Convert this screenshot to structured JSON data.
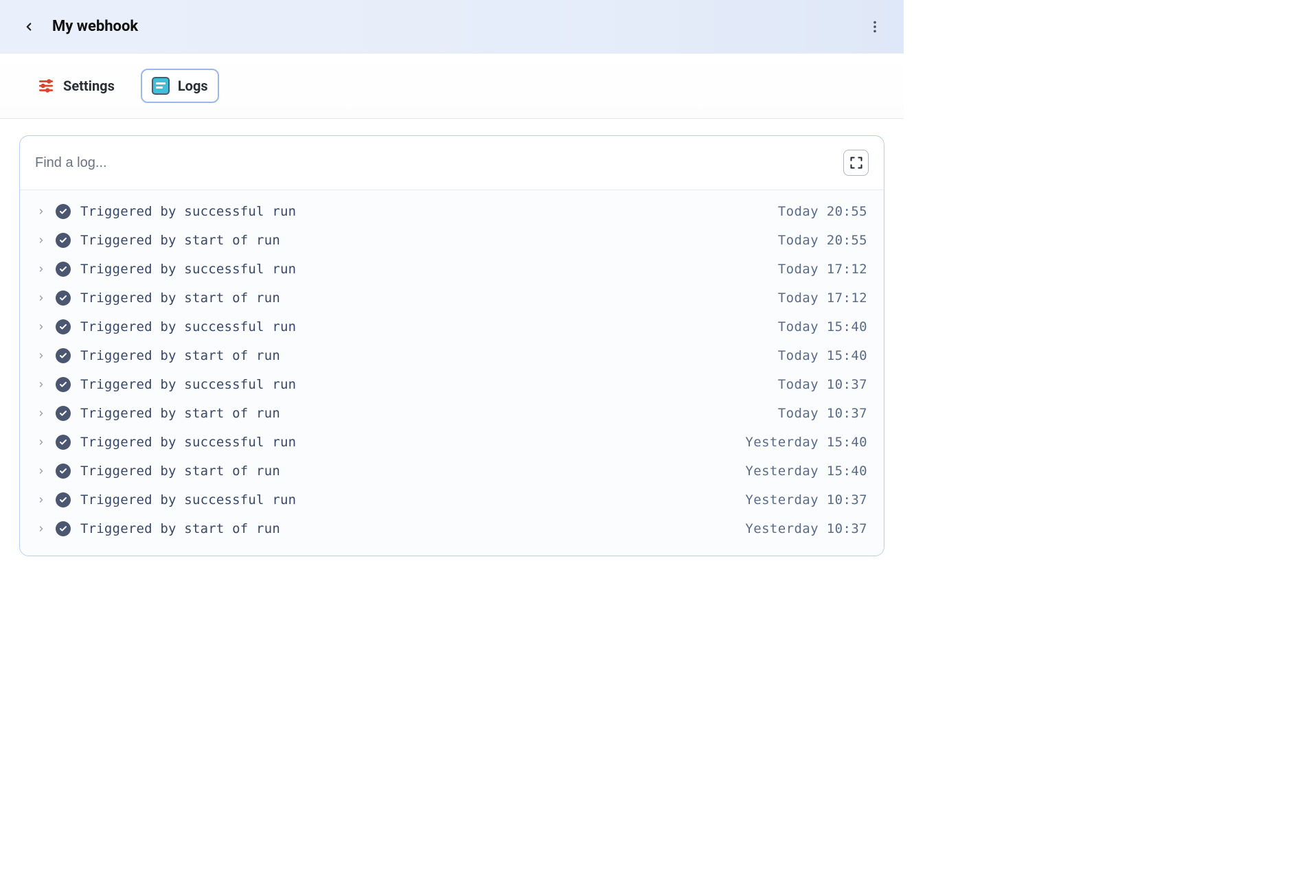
{
  "header": {
    "title": "My webhook"
  },
  "tabs": {
    "settings_label": "Settings",
    "logs_label": "Logs"
  },
  "search": {
    "placeholder": "Find a log..."
  },
  "logs": [
    {
      "message": "Triggered by successful run",
      "timestamp": "Today 20:55"
    },
    {
      "message": "Triggered by start of run",
      "timestamp": "Today 20:55"
    },
    {
      "message": "Triggered by successful run",
      "timestamp": "Today 17:12"
    },
    {
      "message": "Triggered by start of run",
      "timestamp": "Today 17:12"
    },
    {
      "message": "Triggered by successful run",
      "timestamp": "Today 15:40"
    },
    {
      "message": "Triggered by start of run",
      "timestamp": "Today 15:40"
    },
    {
      "message": "Triggered by successful run",
      "timestamp": "Today 10:37"
    },
    {
      "message": "Triggered by start of run",
      "timestamp": "Today 10:37"
    },
    {
      "message": "Triggered by successful run",
      "timestamp": "Yesterday 15:40"
    },
    {
      "message": "Triggered by start of run",
      "timestamp": "Yesterday 15:40"
    },
    {
      "message": "Triggered by successful run",
      "timestamp": "Yesterday 10:37"
    },
    {
      "message": "Triggered by start of run",
      "timestamp": "Yesterday 10:37"
    }
  ]
}
